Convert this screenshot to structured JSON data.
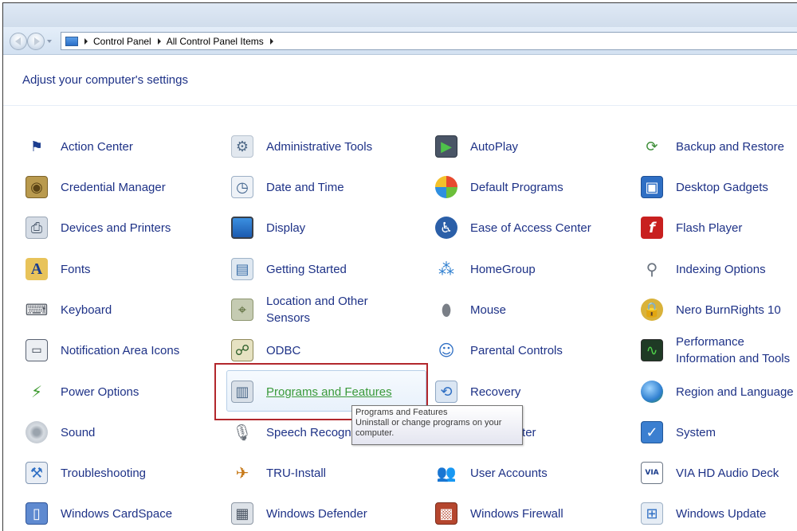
{
  "address_bar": {
    "breadcrumbs": [
      "Control Panel",
      "All Control Panel Items"
    ]
  },
  "page_title": "Adjust your computer's settings",
  "items": [
    {
      "label": "Action Center",
      "icon": "flag-icon"
    },
    {
      "label": "Administrative Tools",
      "icon": "admin-tools-icon"
    },
    {
      "label": "AutoPlay",
      "icon": "autoplay-icon"
    },
    {
      "label": "Backup and Restore",
      "icon": "backup-icon"
    },
    {
      "label": "Credential Manager",
      "icon": "vault-icon"
    },
    {
      "label": "Date and Time",
      "icon": "clock-icon"
    },
    {
      "label": "Default Programs",
      "icon": "default-programs-icon"
    },
    {
      "label": "Desktop Gadgets",
      "icon": "gadgets-icon"
    },
    {
      "label": "Devices and Printers",
      "icon": "printer-icon"
    },
    {
      "label": "Display",
      "icon": "monitor-icon"
    },
    {
      "label": "Ease of Access Center",
      "icon": "accessibility-icon"
    },
    {
      "label": "Flash Player",
      "icon": "flash-icon"
    },
    {
      "label": "Fonts",
      "icon": "font-folder-icon"
    },
    {
      "label": "Getting Started",
      "icon": "getting-started-icon"
    },
    {
      "label": "HomeGroup",
      "icon": "homegroup-icon"
    },
    {
      "label": "Indexing Options",
      "icon": "indexing-icon"
    },
    {
      "label": "Keyboard",
      "icon": "keyboard-icon"
    },
    {
      "label": "Location and Other Sensors",
      "icon": "sensors-icon"
    },
    {
      "label": "Mouse",
      "icon": "mouse-icon"
    },
    {
      "label": "Nero BurnRights 10",
      "icon": "lock-icon"
    },
    {
      "label": "Notification Area Icons",
      "icon": "taskbar-icon"
    },
    {
      "label": "ODBC",
      "icon": "odbc-icon"
    },
    {
      "label": "Parental Controls",
      "icon": "parental-controls-icon"
    },
    {
      "label": "Performance Information and Tools",
      "icon": "performance-icon"
    },
    {
      "label": "Power Options",
      "icon": "battery-icon"
    },
    {
      "label": "Programs and Features",
      "icon": "programs-icon"
    },
    {
      "label": "Recovery",
      "icon": "recovery-icon"
    },
    {
      "label": "Region and Language",
      "icon": "globe-icon"
    },
    {
      "label": "Sound",
      "icon": "speaker-icon"
    },
    {
      "label": "Speech Recognition",
      "icon": "microphone-icon"
    },
    {
      "label": "Sync Center",
      "icon": "sync-icon"
    },
    {
      "label": "System",
      "icon": "system-icon"
    },
    {
      "label": "Troubleshooting",
      "icon": "troubleshoot-icon"
    },
    {
      "label": "TRU-Install",
      "icon": "tru-install-icon"
    },
    {
      "label": "User Accounts",
      "icon": "users-icon"
    },
    {
      "label": "VIA HD Audio Deck",
      "icon": "via-audio-icon"
    },
    {
      "label": "Windows CardSpace",
      "icon": "cardspace-icon"
    },
    {
      "label": "Windows Defender",
      "icon": "defender-icon"
    },
    {
      "label": "Windows Firewall",
      "icon": "firewall-icon"
    },
    {
      "label": "Windows Update",
      "icon": "update-icon"
    }
  ],
  "tooltip": {
    "title": "Programs and Features",
    "body": "Uninstall or change programs on your computer."
  },
  "colors": {
    "link": "#1e3287",
    "hover_link": "#3a9a3a",
    "callout_border": "#b2272c"
  }
}
